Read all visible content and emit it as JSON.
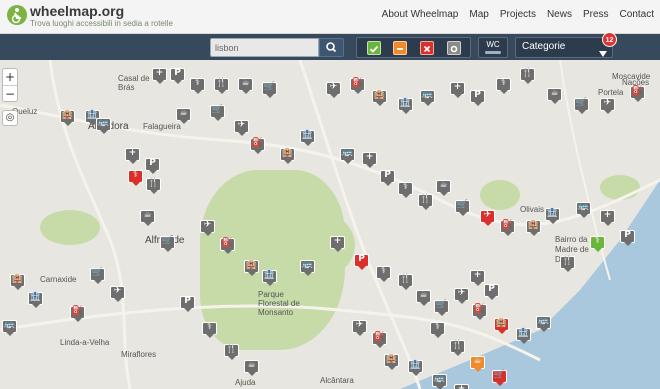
{
  "header": {
    "brand": "wheelmap.org",
    "tagline": "Trova luoghi accessibili in sedia a rotelle",
    "nav": [
      "About Wheelmap",
      "Map",
      "Projects",
      "News",
      "Press",
      "Contact"
    ]
  },
  "toolbar": {
    "search_value": "lisbon",
    "wc_label": "WC",
    "categories_label": "Categorie",
    "categories_count": "12",
    "filter_colors": {
      "accessible": "#6bb53c",
      "limited": "#f08a2c",
      "not_accessible": "#d9302b",
      "unknown": "#8a8a8a"
    }
  },
  "map": {
    "places": [
      "Casal de São Brás",
      "Queluz",
      "Amadora",
      "Falagueira",
      "Alfragide",
      "Carnaxide",
      "Linda-a-Velha",
      "Miraflores",
      "Parque Florestal de Monsanto",
      "Alcântara",
      "Ajuda",
      "Olivais",
      "Bairro da Madre de Deus",
      "Moscavide",
      "Portela",
      "Nações"
    ],
    "colors": {
      "accessible": "#6bb53c",
      "limited": "#f08a2c",
      "not_accessible": "#d9302b",
      "unknown": "#8a8a8a"
    }
  }
}
